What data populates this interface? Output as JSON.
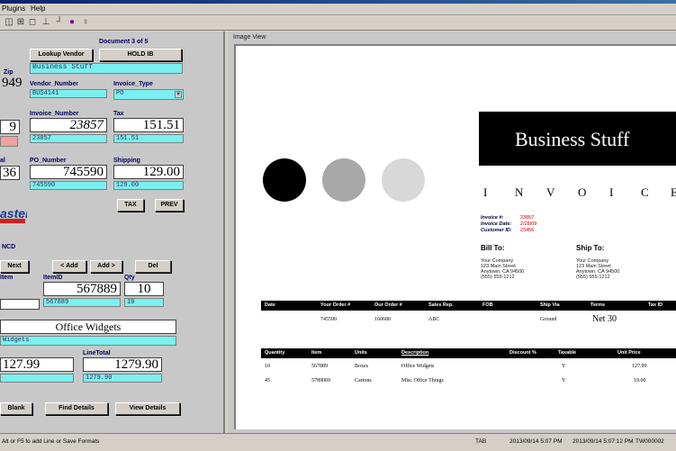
{
  "menu": [
    "Plugins",
    "Help"
  ],
  "toolbar_icons": [
    "split-icon",
    "grid-icon",
    "frame-icon",
    "layout-icon",
    "marker-icon",
    "circle-icon",
    "pin-icon"
  ],
  "left": {
    "doc_counter": "Document 3 of 5",
    "lookup_vendor_label": "Lookup Vendor",
    "hold_label": "HOLD IB",
    "vendor_name": "Business Stuff",
    "zip_label": "Zip",
    "zip_value": "949",
    "vendor_number_label": "Vendor_Number",
    "vendor_number_value": "BUS4141",
    "invoice_type_label": "Invoice_Type",
    "invoice_type_value": "PO",
    "invoice_number_label": "Invoice_Number",
    "invoice_number_value": "23857",
    "invoice_number_small": "23857",
    "left_value_1": "9",
    "tax_label": "Tax",
    "tax_value": "151.51",
    "tax_small": "151.51",
    "po_number_label": "PO_Number",
    "po_number_value": "745590",
    "po_number_small": "745590",
    "left_value_2": "36",
    "shipping_label": "Shipping",
    "shipping_value": "129.00",
    "shipping_small": "129.00",
    "tax_btn": "TAX",
    "prev_btn": "PREV",
    "logo_text": "aster",
    "section_label": "NCD",
    "next_btn": "Next",
    "add_left_btn": "< Add",
    "add_right_btn": "Add >",
    "del_btn": "Del",
    "item_label": "Item",
    "item_id_label": "ItemID",
    "item_id_value": "567889",
    "item_id_small": "567889",
    "qty_label": "Qty",
    "qty_value": "10",
    "qty_small": "10",
    "description_value": "Office Widgets",
    "description_small": "Widgets",
    "unit_value": "127.99",
    "line_total_label": "LineTotal",
    "line_total_value": "1279.90",
    "line_total_small": "1279.90",
    "blank_btn": "Blank",
    "find_details_btn": "Find Details",
    "view_details_btn": "View Details"
  },
  "image_view": {
    "caption": "Image View",
    "company": "Business Stuff",
    "invoice_letters": [
      "I",
      "N",
      "V",
      "O",
      "I",
      "C",
      "E"
    ],
    "invoice_no_label": "Invoice #:",
    "invoice_no_value": "23857",
    "invoice_date_label": "Invoice Date:",
    "invoice_date_value": "2/28/09",
    "customer_id_label": "Customer ID:",
    "customer_id_value": "23456",
    "bill_to": "Bill To:",
    "ship_to": "Ship To:",
    "address_lines": [
      "Your Company",
      "123 Main Street",
      "Anytown, CA 94500",
      "(555) 555-1212"
    ],
    "header1": [
      "Date",
      "Your Order #",
      "Our Order #",
      "Sales Rep.",
      "FOB",
      "Ship Via",
      "Terms",
      "Tax ID"
    ],
    "row1": {
      "order": "745590",
      "our_order": "160680",
      "rep": "ABC",
      "ship_via": "Ground",
      "terms": "Net 30"
    },
    "header2": [
      "Quantity",
      "Item",
      "Units",
      "Description",
      "Discount %",
      "Taxable",
      "Unit Price"
    ],
    "rows2": [
      {
        "qty": "10",
        "item": "567889",
        "units": "Boxes",
        "desc": "Office Widgets",
        "taxable": "Y",
        "price": "127.99"
      },
      {
        "qty": "45",
        "item": "5789069",
        "units": "Cartons",
        "desc": "Misc Office Things",
        "taxable": "Y",
        "price": "19.00"
      }
    ]
  },
  "status": {
    "left": "Alt or F5 to add Line or Save Formats",
    "mode": "TAB",
    "date1": "2013/09/14 5:07 PM",
    "date2": "2013/09/14 5:07:12 PM",
    "code": "TW000002"
  }
}
